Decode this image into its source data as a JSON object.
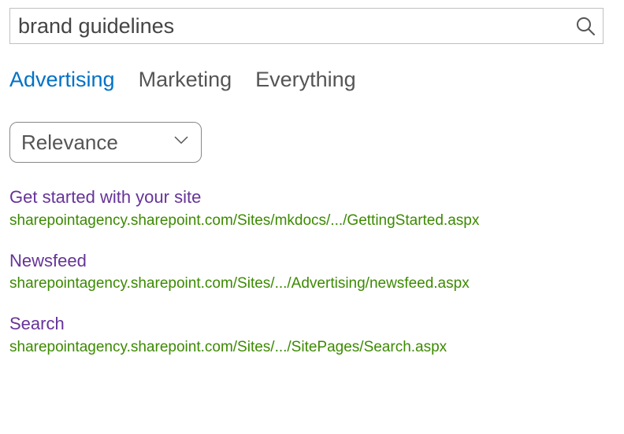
{
  "search": {
    "query": "brand guidelines"
  },
  "tabs": [
    {
      "label": "Advertising",
      "active": true
    },
    {
      "label": "Marketing",
      "active": false
    },
    {
      "label": "Everything",
      "active": false
    }
  ],
  "sort": {
    "selected": "Relevance"
  },
  "results": [
    {
      "title": "Get started with your site",
      "url": "sharepointagency.sharepoint.com/Sites/mkdocs/.../GettingStarted.aspx"
    },
    {
      "title": "Newsfeed",
      "url": "sharepointagency.sharepoint.com/Sites/.../Advertising/newsfeed.aspx"
    },
    {
      "title": "Search",
      "url": "sharepointagency.sharepoint.com/Sites/.../SitePages/Search.aspx"
    }
  ]
}
